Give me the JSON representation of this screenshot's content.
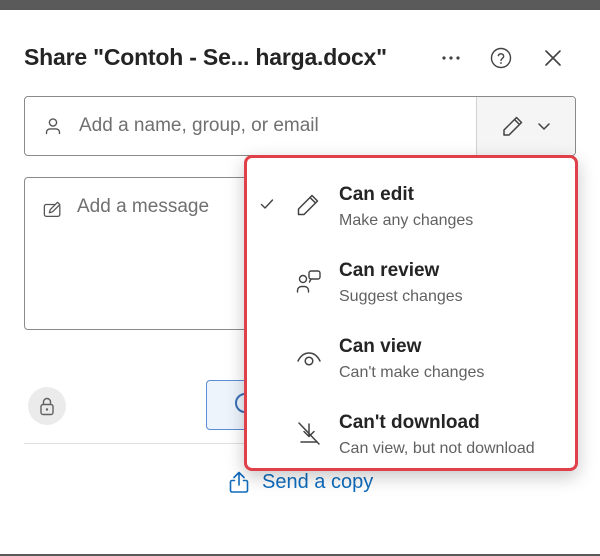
{
  "dialog": {
    "title": "Share \"Contoh - Se... harga.docx\"",
    "more_icon": "more-horizontal-icon",
    "help_icon": "help-circle-icon",
    "close_icon": "close-icon"
  },
  "recipients": {
    "placeholder": "Add a name, group, or email",
    "icon": "person-icon",
    "permission_icon": "pencil-icon",
    "chevron_icon": "chevron-down-icon"
  },
  "message": {
    "placeholder": "Add a message",
    "icon": "compose-icon"
  },
  "footer": {
    "lock_icon": "lock-icon",
    "send_copy_label": "Send a copy",
    "send_copy_icon": "share-upload-icon"
  },
  "permission_menu": {
    "items": [
      {
        "title": "Can edit",
        "subtitle": "Make any changes",
        "icon": "pencil-icon",
        "selected": true
      },
      {
        "title": "Can review",
        "subtitle": "Suggest changes",
        "icon": "review-icon",
        "selected": false
      },
      {
        "title": "Can view",
        "subtitle": "Can't make changes",
        "icon": "eye-icon",
        "selected": false
      },
      {
        "title": "Can't download",
        "subtitle": "Can view, but not download",
        "icon": "no-download-icon",
        "selected": false
      }
    ]
  },
  "colors": {
    "accent": "#0f6cbd",
    "highlight_border": "#e0404a",
    "text_primary": "#242424",
    "text_secondary": "#616161"
  }
}
